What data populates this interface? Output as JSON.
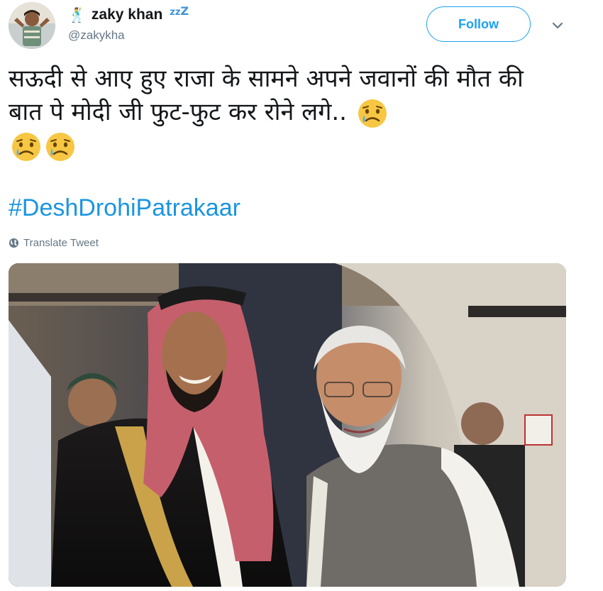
{
  "user": {
    "name_emoji": "🕺",
    "display_name": "zaky khan",
    "name_suffix_small": "zz",
    "name_suffix_big": "Z",
    "handle": "@zakykha"
  },
  "follow_label": "Follow",
  "tweet": {
    "text": "सऊदी से आए हुए राजा के सामने अपने जवानों की मौत की बात पे मोदी जी फुट-फुट कर रोने लगे..",
    "hashtag": "#DeshDrohiPatrakaar",
    "translate_label": "Translate Tweet",
    "emoji_count": 3
  },
  "colors": {
    "accent": "#1da1f2",
    "link": "#1b95e0",
    "secondary_text": "#657786"
  },
  "icons": [
    "dancing-man-emoji-icon",
    "zzz-icon",
    "chevron-down-icon",
    "crying-face-icon",
    "globe-icon"
  ]
}
